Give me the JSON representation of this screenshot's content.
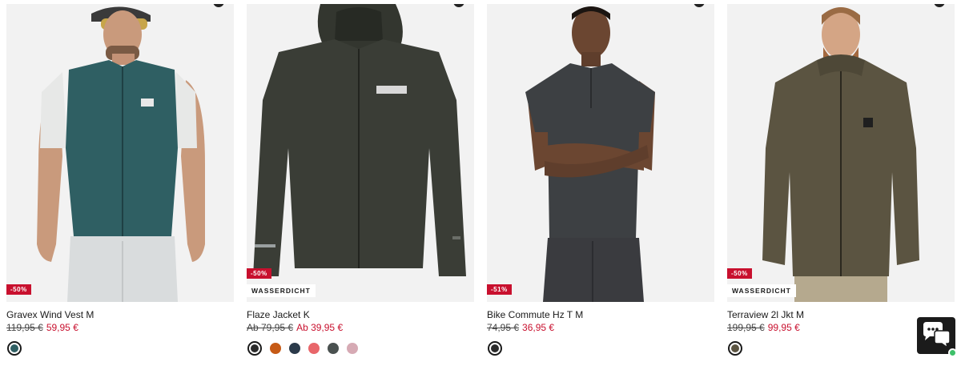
{
  "products": [
    {
      "name": "Gravex Wind Vest M",
      "price_old": "119,95 €",
      "price_new": "59,95 €",
      "discount_badge": "-50%",
      "feature_badge": "",
      "swatches": [
        "#2f5f63"
      ],
      "image_icon": "wind-vest-photo"
    },
    {
      "name": "Flaze Jacket K",
      "price_old": "Ab 79,95 €",
      "price_new": "Ab 39,95 €",
      "discount_badge": "-50%",
      "feature_badge": "WASSERDICHT",
      "swatches": [
        "#2b2b2b",
        "#c65a16",
        "#2b3a4a",
        "#e8666a",
        "#4a5150",
        "#d6aab4"
      ],
      "image_icon": "rain-jacket-photo"
    },
    {
      "name": "Bike Commute Hz T M",
      "price_old": "74,95 €",
      "price_new": "36,95 €",
      "discount_badge": "-51%",
      "feature_badge": "",
      "swatches": [
        "#2a2a2a"
      ],
      "image_icon": "bike-shirt-photo"
    },
    {
      "name": "Terraview 2l Jkt M",
      "price_old": "199,95 €",
      "price_new": "99,95 €",
      "discount_badge": "-50%",
      "feature_badge": "WASSERDICHT",
      "swatches": [
        "#5b5441"
      ],
      "image_icon": "terraview-jacket-photo"
    }
  ],
  "chat_widget": {
    "icon": "chat-bubbles-icon",
    "status": "online"
  },
  "colors": {
    "sale": "#c8102e",
    "text": "#1a1a1a",
    "image_bg": "#f2f2f2"
  }
}
